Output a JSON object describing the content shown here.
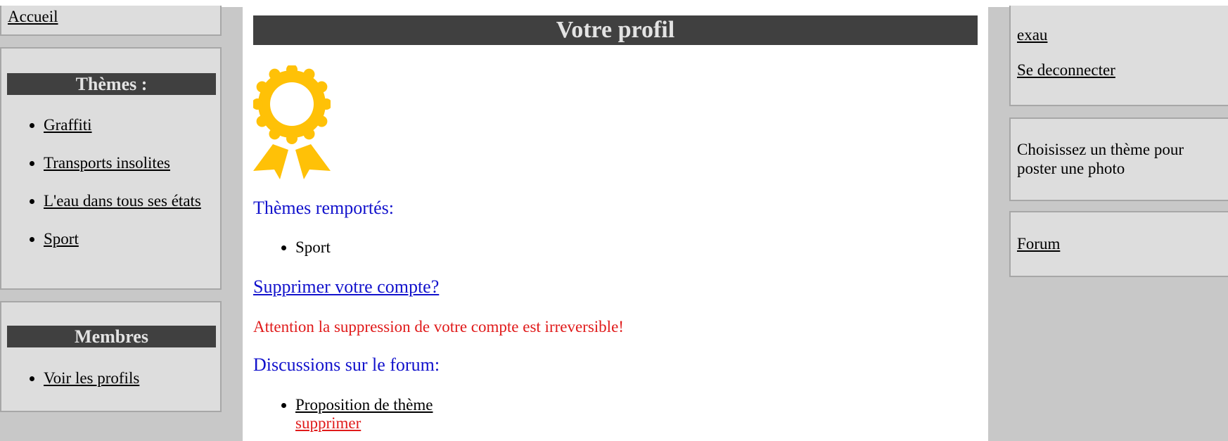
{
  "left_sidebar": {
    "home_link": "Accueil",
    "themes": {
      "title": "Thèmes :",
      "items": [
        "Graffiti",
        "Transports insolites",
        "L'eau dans tous ses états",
        "Sport"
      ]
    },
    "members": {
      "title": "Membres",
      "items": [
        "Voir les profils"
      ]
    }
  },
  "main": {
    "title": "Votre profil",
    "badge_icon": "award-ribbon-icon",
    "won_themes_heading": "Thèmes remportés:",
    "won_themes": [
      "Sport"
    ],
    "delete_account_link": "Supprimer votre compte?",
    "delete_warning": "Attention la suppression de votre compte est irreversible!",
    "forum_heading": "Discussions sur le forum:",
    "forum_discussions": [
      {
        "title": "Proposition de thème",
        "delete_label": "supprimer"
      }
    ]
  },
  "right_sidebar": {
    "username": "exau",
    "logout_link": "Se deconnecter",
    "choose_theme_text": "Choisissez un thème pour poster une photo",
    "forum_link": "Forum"
  },
  "colors": {
    "page_background": "#c8c8c8",
    "box_background": "#dddddd",
    "title_bar": "#404040",
    "heading_blue": "#1212cc",
    "warning_red": "#e01a1a",
    "badge_gold": "#ffc107"
  }
}
